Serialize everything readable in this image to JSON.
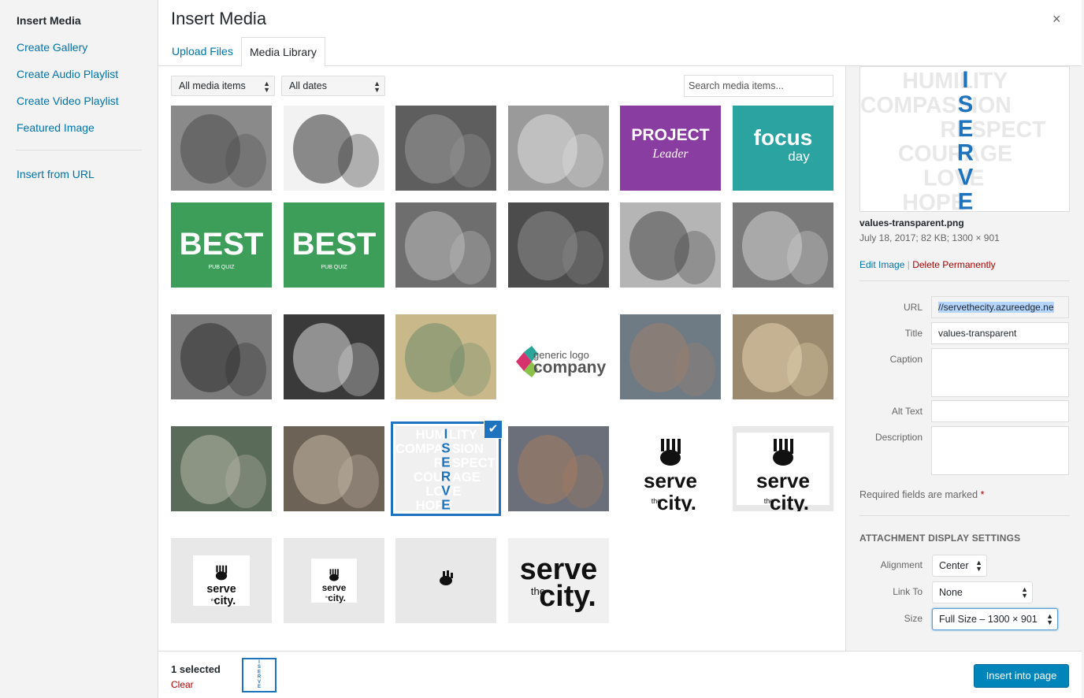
{
  "menu": {
    "items": [
      "Insert Media",
      "Create Gallery",
      "Create Audio Playlist",
      "Create Video Playlist",
      "Featured Image"
    ],
    "insert_url": "Insert from URL"
  },
  "header": {
    "title": "Insert Media",
    "close": "×"
  },
  "tabs": {
    "upload": "Upload Files",
    "library": "Media Library"
  },
  "filters": {
    "type": "All media items",
    "date": "All dates",
    "search_placeholder": "Search media items..."
  },
  "grid": {
    "items": [
      {
        "name": "two-men-photo",
        "kind": "photo",
        "tone": "#8a8a8a",
        "accent": "#4d4d4d"
      },
      {
        "name": "globe-leaf-photo",
        "kind": "photo",
        "tone": "#f2f2f2",
        "accent": "#333333"
      },
      {
        "name": "dog-fence-photo",
        "kind": "photo",
        "tone": "#5e5e5e",
        "accent": "#999999"
      },
      {
        "name": "hands-sky-photo",
        "kind": "photo",
        "tone": "#9a9a9a",
        "accent": "#e0e0e0"
      },
      {
        "name": "project-leader-logo",
        "kind": "logo",
        "bg": "#8a3da0",
        "text": "PROJECT",
        "text2": "Leader",
        "color": "#ffffff"
      },
      {
        "name": "focus-day-logo",
        "kind": "logo",
        "bg": "#2ba3a0",
        "text": "focus",
        "text2": "day",
        "color": "#ffffff"
      },
      {
        "name": "best-pub-quiz-1",
        "kind": "logo",
        "bg": "#3d9e5a",
        "text": "BEST",
        "text2": "PUB QUIZ",
        "color": "#ffffff"
      },
      {
        "name": "best-pub-quiz-2",
        "kind": "logo",
        "bg": "#3d9e5a",
        "text": "BEST",
        "text2": "PUB QUIZ",
        "color": "#ffffff"
      },
      {
        "name": "man-sitting-photo",
        "kind": "photo",
        "tone": "#6e6e6e",
        "accent": "#bcbcbc"
      },
      {
        "name": "church-interior-photo",
        "kind": "photo",
        "tone": "#4c4c4c",
        "accent": "#8c8c8c"
      },
      {
        "name": "elderly-woman-photo",
        "kind": "photo",
        "tone": "#b5b5b5",
        "accent": "#4a4a4a"
      },
      {
        "name": "elderly-people-photo",
        "kind": "photo",
        "tone": "#7a7a7a",
        "accent": "#d0d0d0"
      },
      {
        "name": "child-smiling-photo",
        "kind": "photo",
        "tone": "#7b7b7b",
        "accent": "#2e2e2e"
      },
      {
        "name": "stop-the-abuse-photo",
        "kind": "photo",
        "tone": "#3a3a3a",
        "accent": "#d9d9d9"
      },
      {
        "name": "world-map-image",
        "kind": "photo",
        "tone": "#c9b98a",
        "accent": "#6d8a6a"
      },
      {
        "name": "generic-logo-company",
        "kind": "logo",
        "bg": "#ffffff",
        "text": "generic logo",
        "text2": "company",
        "color": "#555555"
      },
      {
        "name": "volunteers-photo",
        "kind": "photo",
        "tone": "#6f7b84",
        "accent": "#9c7f6d"
      },
      {
        "name": "sandwiches-photo",
        "kind": "photo",
        "tone": "#9b8a6e",
        "accent": "#e6d3b0"
      },
      {
        "name": "washing-vegetables-photo",
        "kind": "photo",
        "tone": "#5a6b5a",
        "accent": "#b7b7a8"
      },
      {
        "name": "hand-holding-photo",
        "kind": "photo",
        "tone": "#6d6256",
        "accent": "#c4b8a8"
      },
      {
        "name": "values-transparent",
        "kind": "values",
        "bg": "#f0f0f0"
      },
      {
        "name": "children-group-photo",
        "kind": "photo",
        "tone": "#6a6f7a",
        "accent": "#a57b5e"
      },
      {
        "name": "serve-the-city-1",
        "kind": "stc",
        "bg": "#ffffff",
        "inner": "#ffffff"
      },
      {
        "name": "serve-the-city-2",
        "kind": "stc",
        "bg": "#e8e8e8",
        "inner": "#ffffff"
      },
      {
        "name": "serve-the-city-3",
        "kind": "stc-small",
        "bg": "#e8e8e8",
        "inner": "#ffffff"
      },
      {
        "name": "serve-the-city-4",
        "kind": "stc-small",
        "bg": "#e8e8e8",
        "inner": "#ffffff"
      },
      {
        "name": "hand-icon-small",
        "kind": "hand",
        "bg": "#e8e8e8"
      },
      {
        "name": "serve-the-city-large",
        "kind": "stc-large",
        "bg": "#f0f0f0"
      }
    ]
  },
  "selected_index": 20,
  "details": {
    "filename": "values-transparent.png",
    "meta": "July 18, 2017; 82 KB; 1300 × 901",
    "edit": "Edit Image",
    "sep": "|",
    "delete": "Delete Permanently",
    "url_label": "URL",
    "url_value": "//servethecity.azureedge.ne",
    "title_label": "Title",
    "title_value": "values-transparent",
    "caption_label": "Caption",
    "alt_label": "Alt Text",
    "description_label": "Description",
    "required": "Required fields are marked",
    "required_star": "*"
  },
  "display_settings": {
    "heading": "ATTACHMENT DISPLAY SETTINGS",
    "alignment_label": "Alignment",
    "alignment_value": "Center",
    "link_label": "Link To",
    "link_value": "None",
    "size_label": "Size",
    "size_value": "Full Size – 1300 × 901"
  },
  "values_words": [
    "HUMILITY",
    "COMPASSION",
    "RESPECT",
    "COURAGE",
    "LOVE",
    "HOPE"
  ],
  "values_vertical": "ISERVE",
  "footer": {
    "selected": "1 selected",
    "clear": "Clear",
    "insert": "Insert into page"
  },
  "stc": {
    "serve": "serve",
    "the": "the",
    "city": "city."
  },
  "colors": {
    "link": "#0073aa",
    "danger": "#aa0000",
    "primary": "#0085ba",
    "selected": "#1e73be",
    "values_blue": "#1e73be"
  }
}
